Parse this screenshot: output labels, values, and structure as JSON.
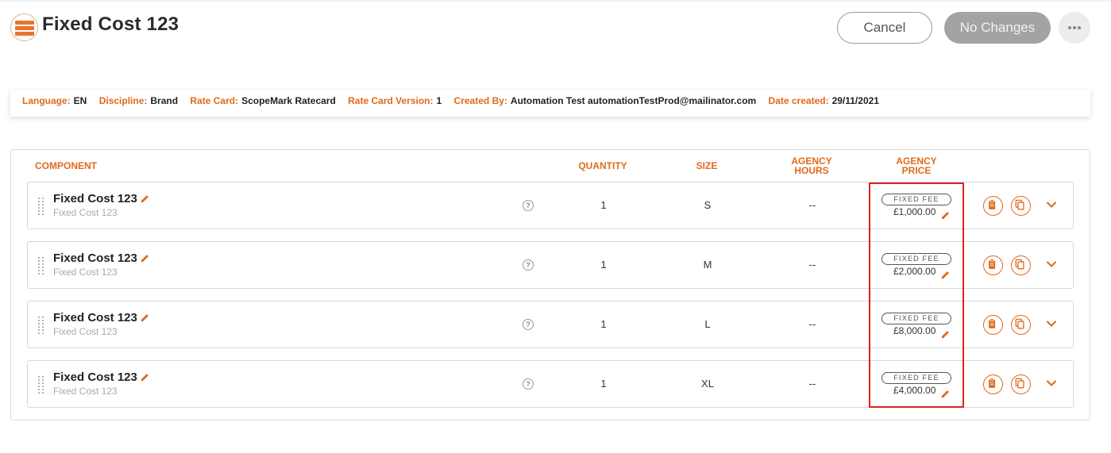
{
  "header": {
    "title": "Fixed Cost 123",
    "cancel_label": "Cancel",
    "no_changes_label": "No Changes",
    "more_icon": "more-horizontal-icon"
  },
  "meta": [
    {
      "key": "Language:",
      "value": "EN"
    },
    {
      "key": "Discipline:",
      "value": "Brand"
    },
    {
      "key": "Rate Card:",
      "value": "ScopeMark Ratecard"
    },
    {
      "key": "Rate Card Version:",
      "value": "1"
    },
    {
      "key": "Created By:",
      "value": "Automation Test automationTestProd@mailinator.com"
    },
    {
      "key": "Date created:",
      "value": "29/11/2021"
    }
  ],
  "table": {
    "headers": {
      "component": "COMPONENT",
      "quantity": "QUANTITY",
      "size": "SIZE",
      "agency_hours_1": "AGENCY",
      "agency_hours_2": "HOURS",
      "agency_price_1": "AGENCY",
      "agency_price_2": "PRICE"
    },
    "rows": [
      {
        "name": "Fixed Cost 123",
        "subtitle": "Fixed Cost 123",
        "help": "?",
        "quantity": "1",
        "size": "S",
        "hours": "--",
        "fee_label": "FIXED FEE",
        "price": "£1,000.00"
      },
      {
        "name": "Fixed Cost 123",
        "subtitle": "Fixed Cost 123",
        "help": "?",
        "quantity": "1",
        "size": "M",
        "hours": "--",
        "fee_label": "FIXED FEE",
        "price": "£2,000.00"
      },
      {
        "name": "Fixed Cost 123",
        "subtitle": "Fixed Cost 123",
        "help": "?",
        "quantity": "1",
        "size": "L",
        "hours": "--",
        "fee_label": "FIXED FEE",
        "price": "£8,000.00"
      },
      {
        "name": "Fixed Cost 123",
        "subtitle": "Fixed Cost 123",
        "help": "?",
        "quantity": "1",
        "size": "XL",
        "hours": "--",
        "fee_label": "FIXED FEE",
        "price": "£4,000.00"
      }
    ]
  },
  "colors": {
    "accent": "#e06a1b",
    "highlight": "#e02020",
    "disabled_button": "#a3a3a3"
  }
}
